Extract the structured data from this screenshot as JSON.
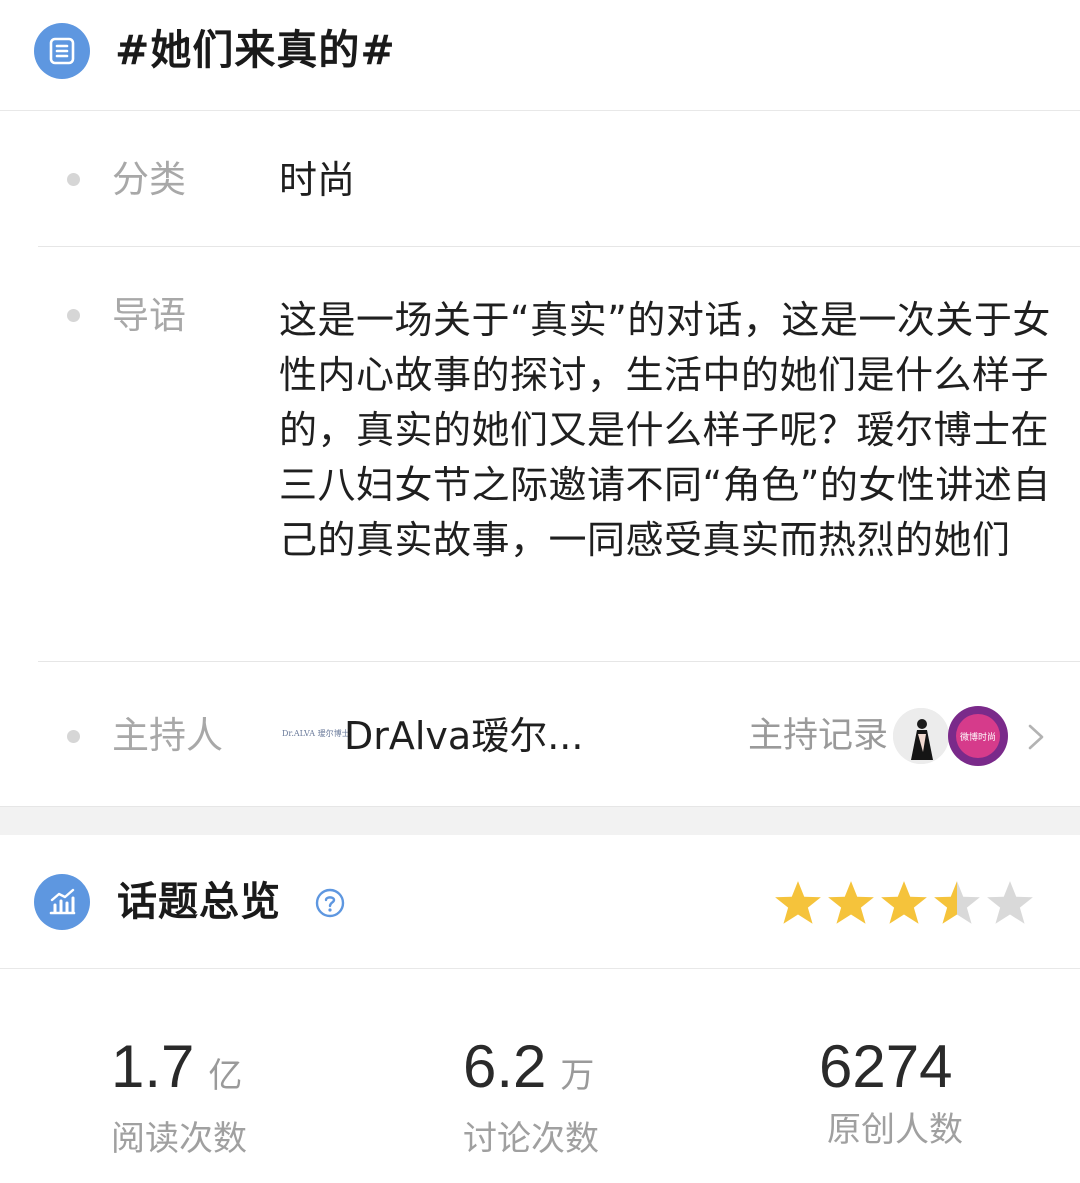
{
  "header": {
    "title": "#她们来真的#",
    "icon": "list-icon"
  },
  "info": {
    "category": {
      "label": "分类",
      "value": "时尚"
    },
    "intro": {
      "label": "导语",
      "value": "这是一场关于“真实”的对话，这是一次关于女性内心故事的探讨，生活中的她们是什么样子的，真实的她们又是什么样子呢？瑷尔博士在三八妇女节之际邀请不同“角色”的女性讲述自己的真实故事，一同感受真实而热烈的她们"
    },
    "host": {
      "label": "主持人",
      "name": "DrAlva瑷尔...",
      "logo_text": "Dr.ALVA 瑷尔博士",
      "record_label": "主持记录",
      "avatar2_text": "微博时尚"
    }
  },
  "overview": {
    "title": "话题总览",
    "icon": "chart-icon",
    "help_icon": "question-circle-icon",
    "rating": 3.5,
    "rating_max": 5,
    "star_color": "#f5c33b",
    "star_empty_color": "#d9d9d9"
  },
  "stats": [
    {
      "value": "1.7",
      "unit": "亿",
      "caption": "阅读次数"
    },
    {
      "value": "6.2",
      "unit": "万",
      "caption": "讨论次数"
    },
    {
      "value": "6274",
      "unit": "",
      "caption": "原创人数"
    }
  ],
  "colors": {
    "accent": "#5e97e0"
  }
}
